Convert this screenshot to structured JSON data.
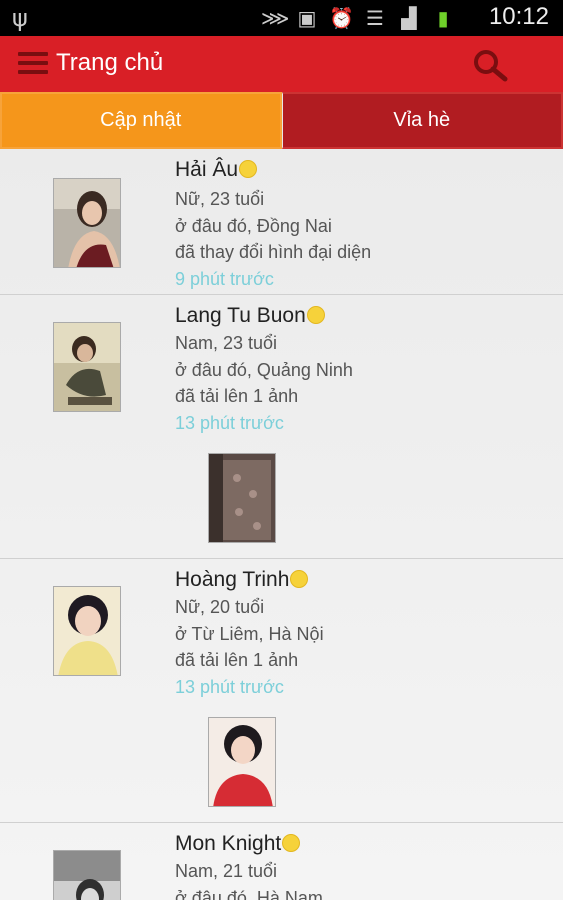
{
  "statusbar": {
    "time": "10:12"
  },
  "appbar": {
    "title": "Trang chủ"
  },
  "tabs": [
    {
      "label": "Cập nhật"
    },
    {
      "label": "Vỉa hè"
    }
  ],
  "feed": [
    {
      "name": "Hải Âu",
      "line1": "Nữ, 23 tuổi",
      "line2": "ở đâu đó, Đồng Nai",
      "line3": "đã thay đổi hình đại diện",
      "time": "9 phút trước"
    },
    {
      "name": "Lang Tu Buon",
      "line1": "Nam, 23 tuổi",
      "line2": "ở đâu đó, Quảng Ninh",
      "line3": "đã tải lên 1 ảnh",
      "time": "13 phút trước"
    },
    {
      "name": "Hoàng Trinh",
      "line1": "Nữ, 20 tuổi",
      "line2": "ở Từ Liêm, Hà Nội",
      "line3": "đã tải lên 1 ảnh",
      "time": "13 phút trước"
    },
    {
      "name": "Mon Knight",
      "line1": "Nam, 21 tuổi",
      "line2": "ở đâu đó, Hà Nam",
      "line3": "",
      "time": ""
    }
  ]
}
